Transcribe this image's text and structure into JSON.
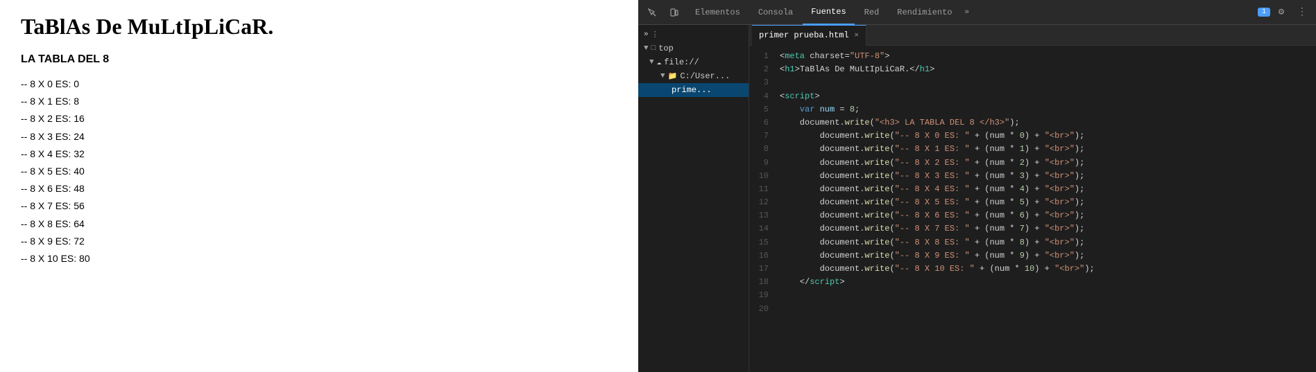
{
  "left": {
    "title": "TaBlAs De MuLtIpLiCaR.",
    "subtitle": "LA TABLA DEL 8",
    "lines": [
      "-- 8 X 0 ES: 0",
      "-- 8 X 1 ES: 8",
      "-- 8 X 2 ES: 16",
      "-- 8 X 3 ES: 24",
      "-- 8 X 4 ES: 32",
      "-- 8 X 5 ES: 40",
      "-- 8 X 6 ES: 48",
      "-- 8 X 7 ES: 56",
      "-- 8 X 8 ES: 64",
      "-- 8 X 9 ES: 72",
      "-- 8 X 10 ES: 80"
    ]
  },
  "devtools": {
    "tabs": [
      "Elementos",
      "Consola",
      "Fuentes",
      "Red",
      "Rendimiento"
    ],
    "active_tab": "Fuentes",
    "more_label": "»",
    "badge": "1",
    "file_tree": [
      {
        "label": "top",
        "icon": "▶ □",
        "indent": 0
      },
      {
        "label": "file://",
        "icon": "☁",
        "indent": 1
      },
      {
        "label": "C:/User...",
        "icon": "📁",
        "indent": 2
      },
      {
        "label": "prime...",
        "icon": "",
        "indent": 3
      }
    ],
    "file_tab": "primer prueba.html",
    "lines": 20,
    "code": [
      {
        "num": 1,
        "tokens": [
          {
            "t": "<",
            "c": "plain"
          },
          {
            "t": "meta",
            "c": "tag"
          },
          {
            "t": " charset=",
            "c": "plain"
          },
          {
            "t": "\"UTF-8\"",
            "c": "str"
          },
          {
            "t": ">",
            "c": "plain"
          }
        ]
      },
      {
        "num": 2,
        "tokens": [
          {
            "t": "<",
            "c": "plain"
          },
          {
            "t": "h1",
            "c": "tag"
          },
          {
            "t": ">TaBlAs De MuLtIpLiCaR.</",
            "c": "plain"
          },
          {
            "t": "h1",
            "c": "tag"
          },
          {
            "t": ">",
            "c": "plain"
          }
        ]
      },
      {
        "num": 3,
        "tokens": []
      },
      {
        "num": 4,
        "tokens": [
          {
            "t": "<",
            "c": "plain"
          },
          {
            "t": "script",
            "c": "tag"
          },
          {
            "t": ">",
            "c": "plain"
          }
        ]
      },
      {
        "num": 5,
        "tokens": [
          {
            "t": "    var ",
            "c": "kw"
          },
          {
            "t": "num",
            "c": "prop"
          },
          {
            "t": " = ",
            "c": "plain"
          },
          {
            "t": "8",
            "c": "num"
          },
          {
            "t": ";",
            "c": "plain"
          }
        ]
      },
      {
        "num": 6,
        "tokens": [
          {
            "t": "    document.",
            "c": "plain"
          },
          {
            "t": "write",
            "c": "fn"
          },
          {
            "t": "(",
            "c": "plain"
          },
          {
            "t": "\"<h3> LA TABLA DEL 8 </h3>\"",
            "c": "str"
          },
          {
            "t": ");",
            "c": "plain"
          }
        ]
      },
      {
        "num": 7,
        "tokens": [
          {
            "t": "        document.",
            "c": "plain"
          },
          {
            "t": "write",
            "c": "fn"
          },
          {
            "t": "(",
            "c": "plain"
          },
          {
            "t": "\"-- 8 X 0 ES: \"",
            "c": "str"
          },
          {
            "t": " + (num * ",
            "c": "plain"
          },
          {
            "t": "0",
            "c": "num"
          },
          {
            "t": ") + ",
            "c": "plain"
          },
          {
            "t": "\"<br>\"",
            "c": "str"
          },
          {
            "t": ");",
            "c": "plain"
          }
        ]
      },
      {
        "num": 8,
        "tokens": [
          {
            "t": "        document.",
            "c": "plain"
          },
          {
            "t": "write",
            "c": "fn"
          },
          {
            "t": "(",
            "c": "plain"
          },
          {
            "t": "\"-- 8 X 1 ES: \"",
            "c": "str"
          },
          {
            "t": " + (num * ",
            "c": "plain"
          },
          {
            "t": "1",
            "c": "num"
          },
          {
            "t": ") + ",
            "c": "plain"
          },
          {
            "t": "\"<br>\"",
            "c": "str"
          },
          {
            "t": ");",
            "c": "plain"
          }
        ]
      },
      {
        "num": 9,
        "tokens": [
          {
            "t": "        document.",
            "c": "plain"
          },
          {
            "t": "write",
            "c": "fn"
          },
          {
            "t": "(",
            "c": "plain"
          },
          {
            "t": "\"-- 8 X 2 ES: \"",
            "c": "str"
          },
          {
            "t": " + (num * ",
            "c": "plain"
          },
          {
            "t": "2",
            "c": "num"
          },
          {
            "t": ") + ",
            "c": "plain"
          },
          {
            "t": "\"<br>\"",
            "c": "str"
          },
          {
            "t": ");",
            "c": "plain"
          }
        ]
      },
      {
        "num": 10,
        "tokens": [
          {
            "t": "        document.",
            "c": "plain"
          },
          {
            "t": "write",
            "c": "fn"
          },
          {
            "t": "(",
            "c": "plain"
          },
          {
            "t": "\"-- 8 X 3 ES: \"",
            "c": "str"
          },
          {
            "t": " + (num * ",
            "c": "plain"
          },
          {
            "t": "3",
            "c": "num"
          },
          {
            "t": ") + ",
            "c": "plain"
          },
          {
            "t": "\"<br>\"",
            "c": "str"
          },
          {
            "t": ");",
            "c": "plain"
          }
        ]
      },
      {
        "num": 11,
        "tokens": [
          {
            "t": "        document.",
            "c": "plain"
          },
          {
            "t": "write",
            "c": "fn"
          },
          {
            "t": "(",
            "c": "plain"
          },
          {
            "t": "\"-- 8 X 4 ES: \"",
            "c": "str"
          },
          {
            "t": " + (num * ",
            "c": "plain"
          },
          {
            "t": "4",
            "c": "num"
          },
          {
            "t": ") + ",
            "c": "plain"
          },
          {
            "t": "\"<br>\"",
            "c": "str"
          },
          {
            "t": ");",
            "c": "plain"
          }
        ]
      },
      {
        "num": 12,
        "tokens": [
          {
            "t": "        document.",
            "c": "plain"
          },
          {
            "t": "write",
            "c": "fn"
          },
          {
            "t": "(",
            "c": "plain"
          },
          {
            "t": "\"-- 8 X 5 ES: \"",
            "c": "str"
          },
          {
            "t": " + (num * ",
            "c": "plain"
          },
          {
            "t": "5",
            "c": "num"
          },
          {
            "t": ") + ",
            "c": "plain"
          },
          {
            "t": "\"<br>\"",
            "c": "str"
          },
          {
            "t": ");",
            "c": "plain"
          }
        ]
      },
      {
        "num": 13,
        "tokens": [
          {
            "t": "        document.",
            "c": "plain"
          },
          {
            "t": "write",
            "c": "fn"
          },
          {
            "t": "(",
            "c": "plain"
          },
          {
            "t": "\"-- 8 X 6 ES: \"",
            "c": "str"
          },
          {
            "t": " + (num * ",
            "c": "plain"
          },
          {
            "t": "6",
            "c": "num"
          },
          {
            "t": ") + ",
            "c": "plain"
          },
          {
            "t": "\"<br>\"",
            "c": "str"
          },
          {
            "t": ");",
            "c": "plain"
          }
        ]
      },
      {
        "num": 14,
        "tokens": [
          {
            "t": "        document.",
            "c": "plain"
          },
          {
            "t": "write",
            "c": "fn"
          },
          {
            "t": "(",
            "c": "plain"
          },
          {
            "t": "\"-- 8 X 7 ES: \"",
            "c": "str"
          },
          {
            "t": " + (num * ",
            "c": "plain"
          },
          {
            "t": "7",
            "c": "num"
          },
          {
            "t": ") + ",
            "c": "plain"
          },
          {
            "t": "\"<br>\"",
            "c": "str"
          },
          {
            "t": ");",
            "c": "plain"
          }
        ]
      },
      {
        "num": 15,
        "tokens": [
          {
            "t": "        document.",
            "c": "plain"
          },
          {
            "t": "write",
            "c": "fn"
          },
          {
            "t": "(",
            "c": "plain"
          },
          {
            "t": "\"-- 8 X 8 ES: \"",
            "c": "str"
          },
          {
            "t": " + (num * ",
            "c": "plain"
          },
          {
            "t": "8",
            "c": "num"
          },
          {
            "t": ") + ",
            "c": "plain"
          },
          {
            "t": "\"<br>\"",
            "c": "str"
          },
          {
            "t": ");",
            "c": "plain"
          }
        ]
      },
      {
        "num": 16,
        "tokens": [
          {
            "t": "        document.",
            "c": "plain"
          },
          {
            "t": "write",
            "c": "fn"
          },
          {
            "t": "(",
            "c": "plain"
          },
          {
            "t": "\"-- 8 X 9 ES: \"",
            "c": "str"
          },
          {
            "t": " + (num * ",
            "c": "plain"
          },
          {
            "t": "9",
            "c": "num"
          },
          {
            "t": ") + ",
            "c": "plain"
          },
          {
            "t": "\"<br>\"",
            "c": "str"
          },
          {
            "t": ");",
            "c": "plain"
          }
        ]
      },
      {
        "num": 17,
        "tokens": [
          {
            "t": "        document.",
            "c": "plain"
          },
          {
            "t": "write",
            "c": "fn"
          },
          {
            "t": "(",
            "c": "plain"
          },
          {
            "t": "\"-- 8 X 10 ES: \"",
            "c": "str"
          },
          {
            "t": " + (num * ",
            "c": "plain"
          },
          {
            "t": "10",
            "c": "num"
          },
          {
            "t": ") + ",
            "c": "plain"
          },
          {
            "t": "\"<br>\"",
            "c": "str"
          },
          {
            "t": ");",
            "c": "plain"
          }
        ]
      },
      {
        "num": 18,
        "tokens": [
          {
            "t": "    </",
            "c": "plain"
          },
          {
            "t": "script",
            "c": "tag"
          },
          {
            "t": ">",
            "c": "plain"
          }
        ]
      },
      {
        "num": 19,
        "tokens": []
      },
      {
        "num": 20,
        "tokens": []
      }
    ]
  }
}
